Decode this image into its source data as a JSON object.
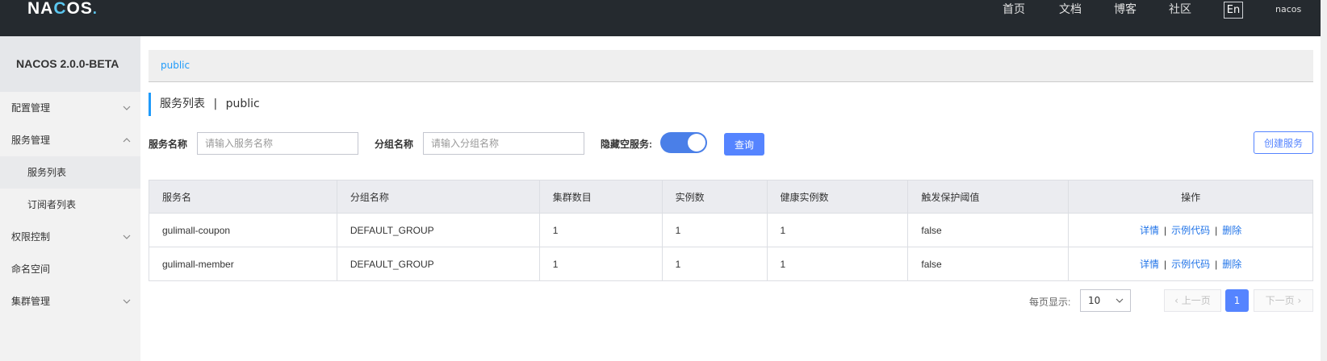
{
  "topbar": {
    "logo_text_a": "NA",
    "logo_text_b": "C",
    "logo_text_c": "OS",
    "nav": [
      "首页",
      "文档",
      "博客",
      "社区"
    ],
    "lang": "En",
    "user": "nacos"
  },
  "sidebar": {
    "title": "NACOS 2.0.0-BETA",
    "items": [
      {
        "label": "配置管理"
      },
      {
        "label": "服务管理"
      },
      {
        "label": "服务列表"
      },
      {
        "label": "订阅者列表"
      },
      {
        "label": "权限控制"
      },
      {
        "label": "命名空间"
      },
      {
        "label": "集群管理"
      }
    ]
  },
  "main": {
    "breadcrumb": "public",
    "title": "服务列表",
    "title_sep": "|",
    "title_ns": "public"
  },
  "filters": {
    "service_name_label": "服务名称",
    "service_name_placeholder": "请输入服务名称",
    "group_name_label": "分组名称",
    "group_name_placeholder": "请输入分组名称",
    "hide_empty_label": "隐藏空服务:",
    "hide_empty_on": true,
    "query_button": "查询",
    "create_button": "创建服务"
  },
  "table": {
    "headers": [
      "服务名",
      "分组名称",
      "集群数目",
      "实例数",
      "健康实例数",
      "触发保护阈值",
      "操作"
    ],
    "rows": [
      [
        "gulimall-coupon",
        "DEFAULT_GROUP",
        "1",
        "1",
        "1",
        "false"
      ],
      [
        "gulimall-member",
        "DEFAULT_GROUP",
        "1",
        "1",
        "1",
        "false"
      ]
    ],
    "actions": [
      "详情",
      "示例代码",
      "删除"
    ]
  },
  "pagination": {
    "page_size_label": "每页显示:",
    "page_size": "10",
    "prev": "上一页",
    "current": "1",
    "next": "下一页"
  },
  "colors": {
    "topbar_bg": "#252a2f",
    "accent": "#5584ff",
    "link": "#2174e8"
  }
}
